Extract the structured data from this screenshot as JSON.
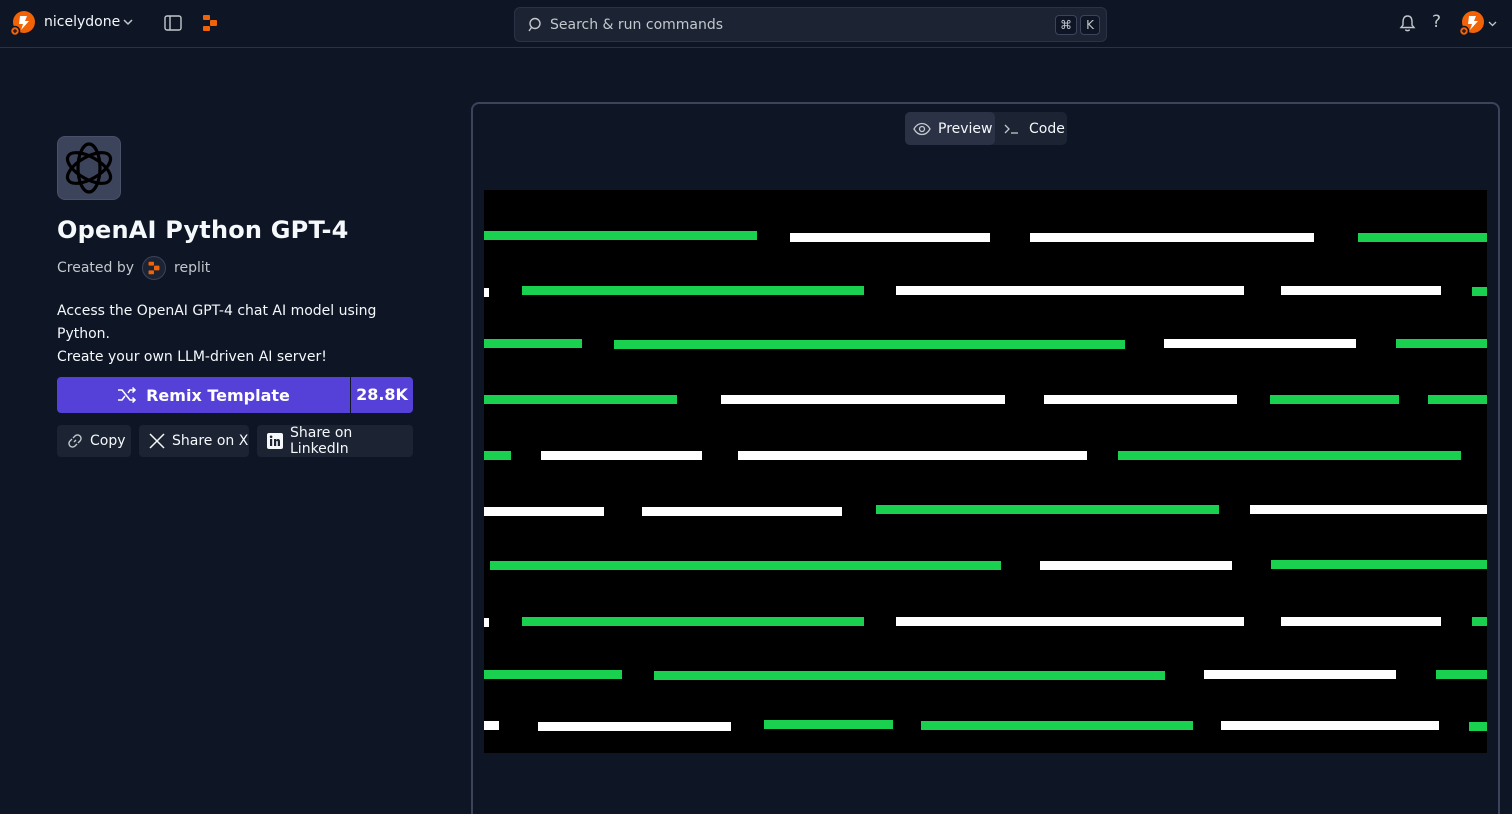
{
  "topbar": {
    "username": "nicelydone",
    "search_placeholder": "Search & run commands",
    "shortcut_cmd": "⌘",
    "shortcut_key": "K",
    "help_label": "?"
  },
  "template": {
    "title": "OpenAI Python GPT-4",
    "created_by_label": "Created by",
    "author": "replit",
    "description_line1": "Access the OpenAI GPT-4 chat AI model using Python.",
    "description_line2": "Create your own LLM-driven AI server!",
    "remix_label": "Remix Template",
    "remix_count": "28.8K",
    "copy_label": "Copy",
    "share_x_label": "Share on X",
    "share_linkedin_label": "Share on LinkedIn"
  },
  "preview": {
    "tab_preview": "Preview",
    "tab_code": "Code",
    "active_tab": "Preview"
  },
  "colors": {
    "accent": "#5541d8",
    "brand_orange": "#f26207",
    "bar_green": "#1ad14f",
    "bar_white": "#ffffff",
    "background": "#0e1525"
  }
}
